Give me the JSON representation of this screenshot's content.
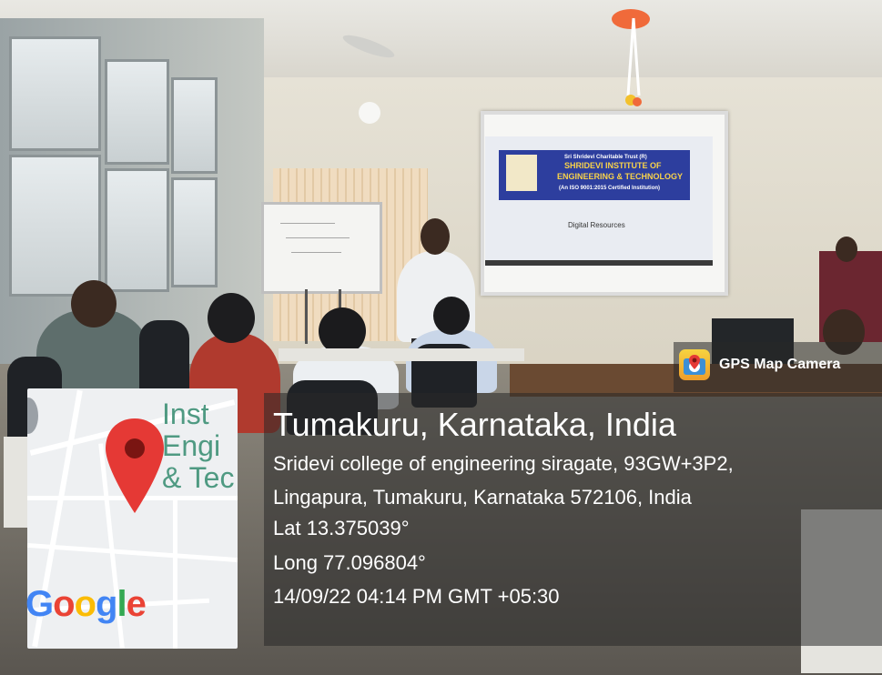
{
  "overlay": {
    "badge_label": "GPS Map Camera",
    "badge_icon": "gps-map-camera-icon",
    "place": "Tumakuru, Karnataka, India",
    "address_line1": "Sridevi college of engineering siragate, 93GW+3P2,",
    "address_line2": "Lingapura, Tumakuru, Karnataka 572106, India",
    "lat": "Lat 13.375039°",
    "long": "Long 77.096804°",
    "datetime": "14/09/22 04:14 PM GMT +05:30"
  },
  "map": {
    "label": "Inst\nEngi\n& Tec",
    "logo_letters": [
      "G",
      "o",
      "o",
      "g",
      "l",
      "e"
    ],
    "logo_colors": [
      "#4285F4",
      "#EA4335",
      "#FBBC05",
      "#4285F4",
      "#34A853",
      "#EA4335"
    ],
    "pin_icon": "map-pin-icon",
    "pin_color": "#E53935"
  },
  "projection": {
    "trust": "Sri Shridevi Charitable Trust (R)",
    "institute_line1": "SHRIDEVI INSTITUTE OF",
    "institute_line2": "ENGINEERING & TECHNOLOGY",
    "iso": "(An ISO 9001:2015 Certified Institution)",
    "page_title": "Digital Resources"
  }
}
